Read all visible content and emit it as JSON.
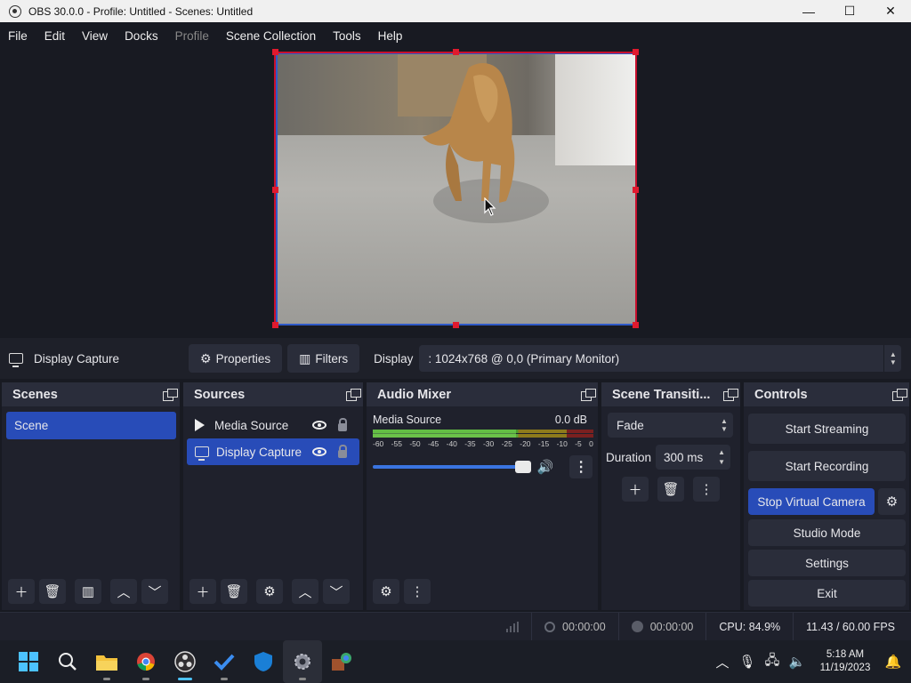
{
  "window": {
    "title": "OBS 30.0.0 - Profile: Untitled - Scenes: Untitled",
    "minimize": "—",
    "maximize": "☐",
    "close": "✕"
  },
  "menu": {
    "items": [
      "File",
      "Edit",
      "View",
      "Docks",
      "Profile",
      "Scene Collection",
      "Tools",
      "Help"
    ],
    "disabled": [
      "Profile"
    ]
  },
  "source_toolbar": {
    "source_name": "Display Capture",
    "properties_label": "Properties",
    "filters_label": "Filters",
    "display_label": "Display",
    "display_value": ": 1024x768 @ 0,0 (Primary Monitor)"
  },
  "scenes": {
    "title": "Scenes",
    "items": [
      "Scene"
    ]
  },
  "sources": {
    "title": "Sources",
    "items": [
      {
        "label": "Media Source",
        "type": "media",
        "visible": true,
        "locked": false
      },
      {
        "label": "Display Capture",
        "type": "display",
        "visible": true,
        "locked": false,
        "selected": true
      }
    ]
  },
  "audio_mixer": {
    "title": "Audio Mixer",
    "channels": [
      {
        "name": "Media Source",
        "level": "0.0 dB",
        "volume_fraction": 1.0,
        "meter_fraction": 0.65
      }
    ],
    "ticks": [
      "-60",
      "-55",
      "-50",
      "-45",
      "-40",
      "-35",
      "-30",
      "-25",
      "-20",
      "-15",
      "-10",
      "-5",
      "0"
    ]
  },
  "transitions": {
    "title": "Scene Transiti...",
    "selected": "Fade",
    "duration_label": "Duration",
    "duration_value": "300 ms"
  },
  "controls": {
    "title": "Controls",
    "start_streaming": "Start Streaming",
    "start_recording": "Start Recording",
    "virtual_camera": "Stop Virtual Camera",
    "studio_mode": "Studio Mode",
    "settings": "Settings",
    "exit": "Exit"
  },
  "status": {
    "stream_time": "00:00:00",
    "record_time": "00:00:00",
    "cpu": "CPU: 84.9%",
    "fps": "11.43 / 60.00 FPS"
  },
  "taskbar": {
    "apps": [
      "start",
      "search",
      "file-explorer",
      "chrome",
      "obs",
      "todo",
      "defender",
      "settings",
      "app"
    ],
    "time": "5:18 AM",
    "date": "11/19/2023"
  },
  "colors": {
    "accent": "#284cb8",
    "selection_red": "#c8102e",
    "panel": "#1f212c",
    "background": "#181a22"
  }
}
